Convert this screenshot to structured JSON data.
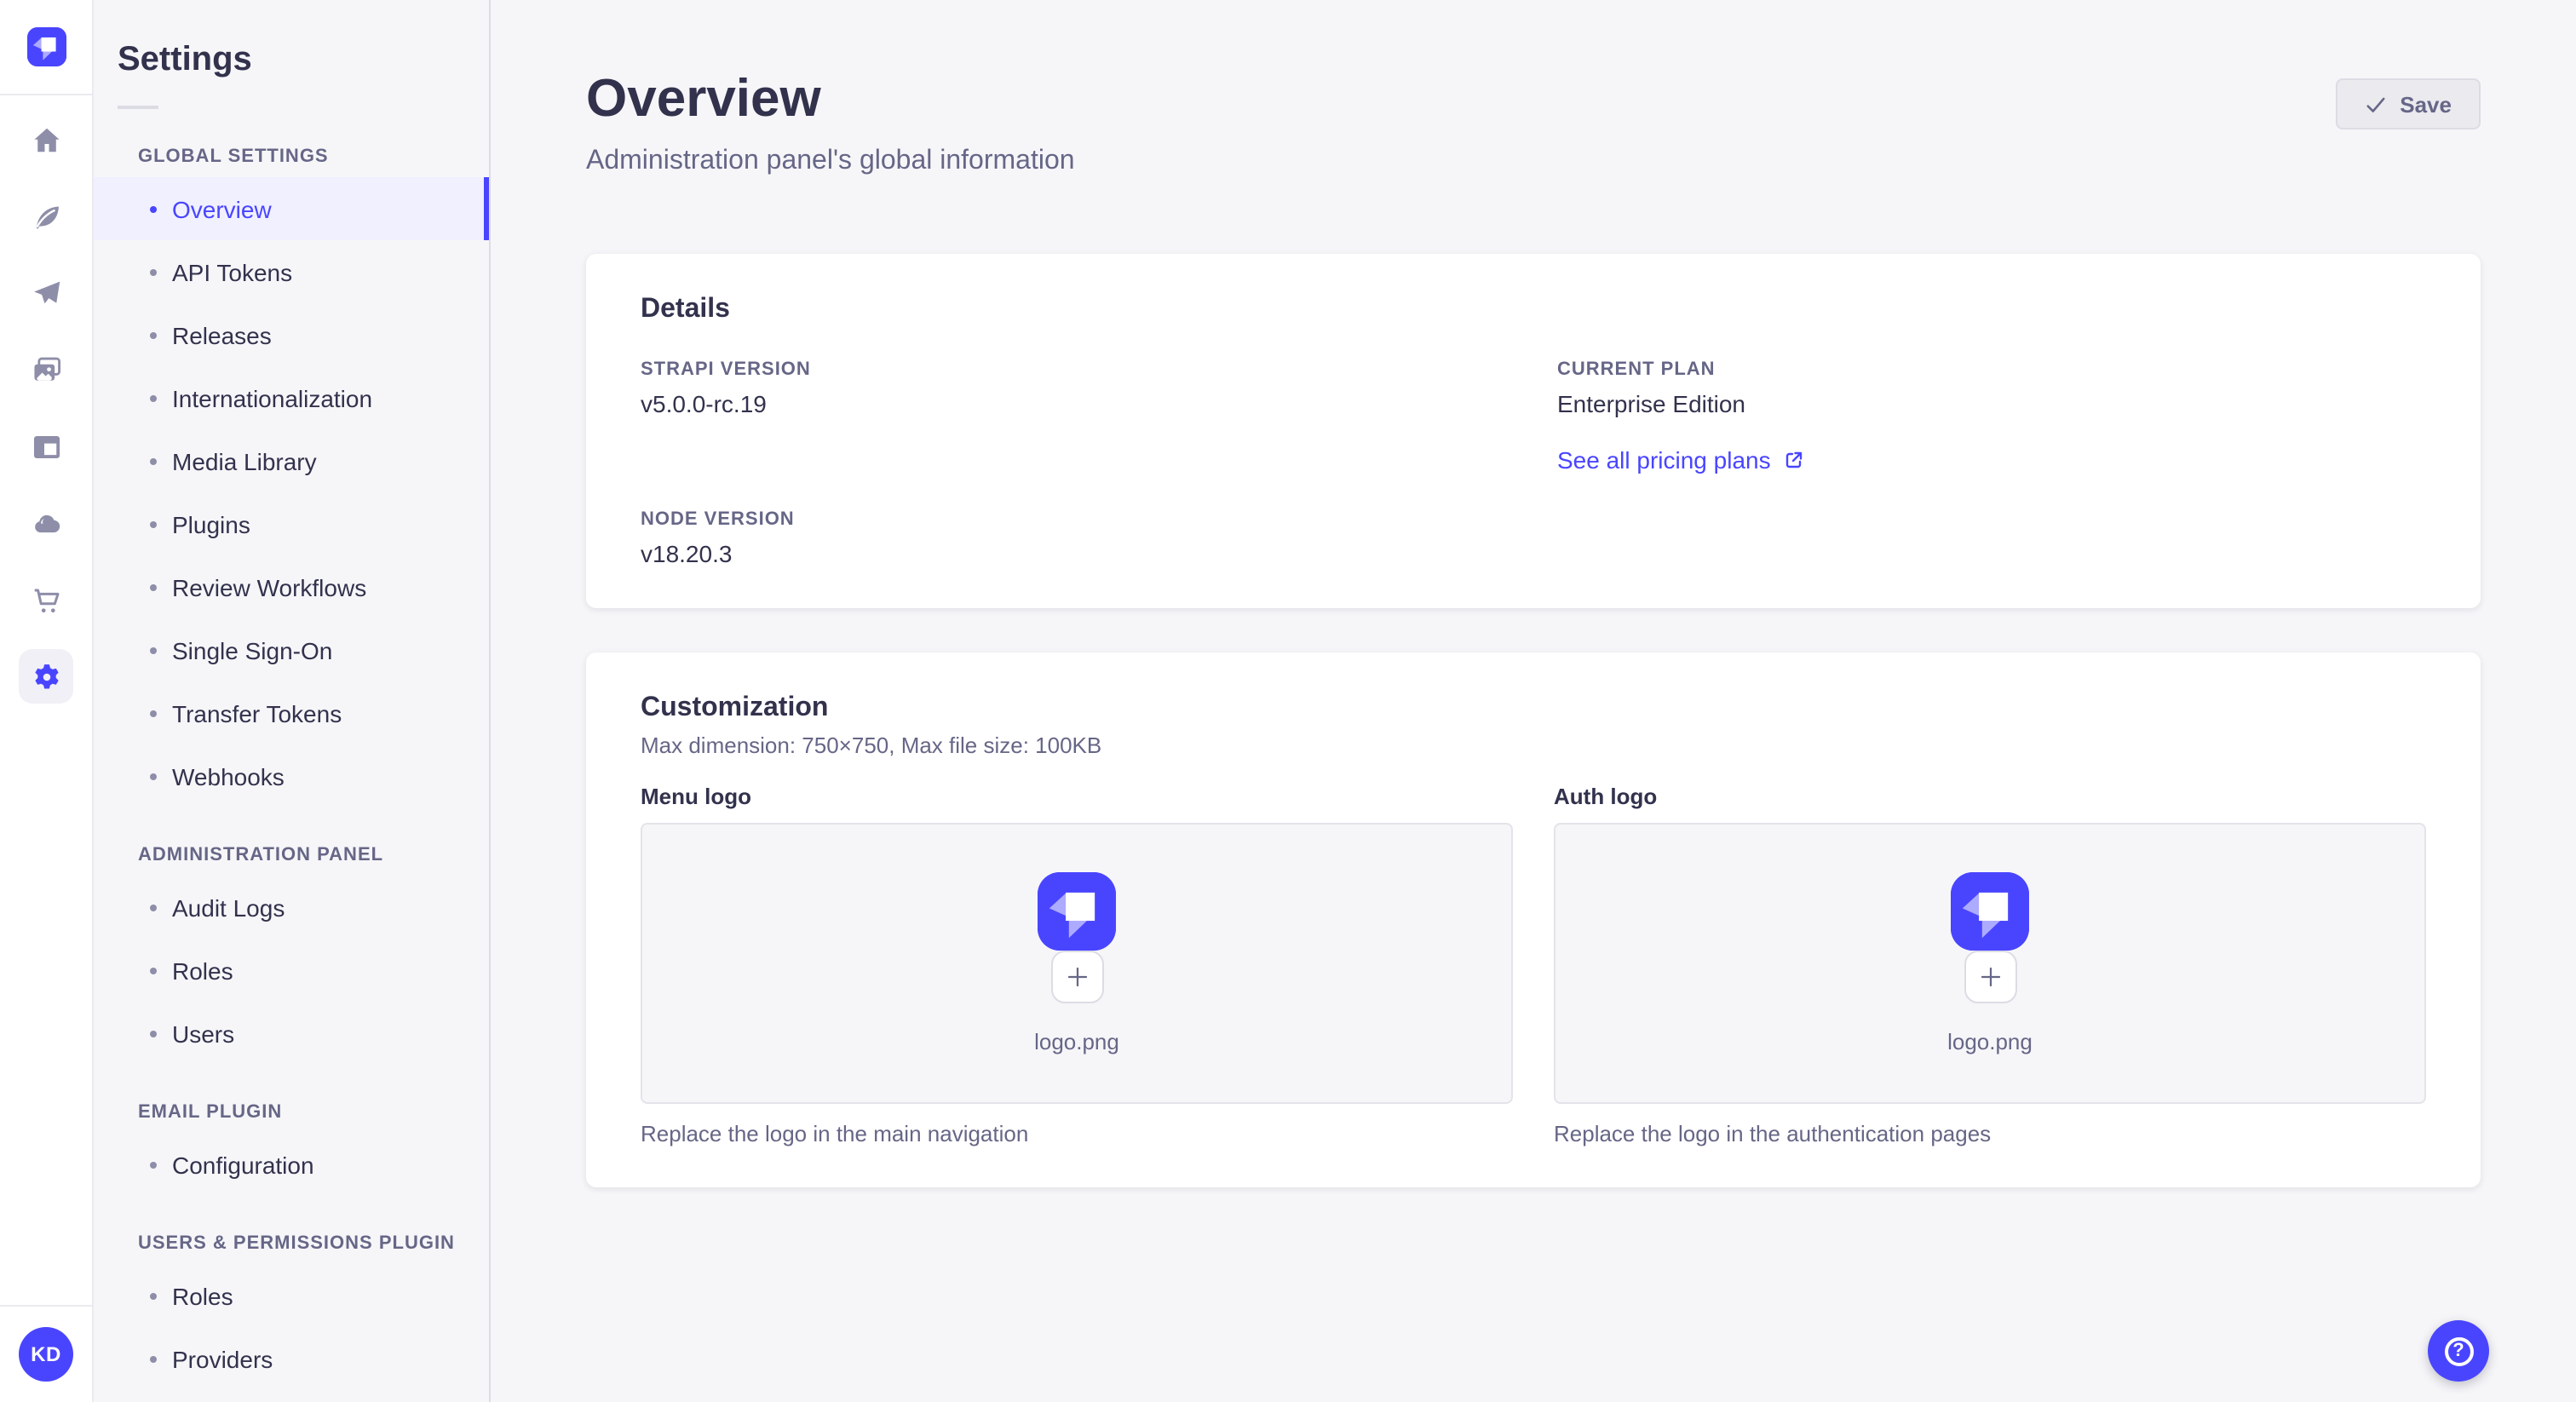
{
  "colors": {
    "accent": "#4945ff",
    "accent_light": "#f0f0ff",
    "text": "#32324d",
    "muted": "#666687",
    "icon_gray": "#8e8ea9",
    "border": "#dcdce4",
    "background": "#f6f6f9",
    "card": "#ffffff"
  },
  "nav_rail": {
    "logo_icon": "strapi-logo",
    "icons": [
      {
        "name": "home",
        "active": false
      },
      {
        "name": "feather",
        "active": false
      },
      {
        "name": "paper-plane",
        "active": false
      },
      {
        "name": "media",
        "active": false
      },
      {
        "name": "layout",
        "active": false
      },
      {
        "name": "cloud",
        "active": false
      },
      {
        "name": "cart",
        "active": false
      },
      {
        "name": "gear",
        "active": true
      }
    ],
    "user": {
      "initials": "KD"
    }
  },
  "subnav": {
    "title": "Settings",
    "sections": [
      {
        "label": "GLOBAL SETTINGS",
        "items": [
          {
            "label": "Overview",
            "active": true
          },
          {
            "label": "API Tokens",
            "active": false
          },
          {
            "label": "Releases",
            "active": false
          },
          {
            "label": "Internationalization",
            "active": false
          },
          {
            "label": "Media Library",
            "active": false
          },
          {
            "label": "Plugins",
            "active": false
          },
          {
            "label": "Review Workflows",
            "active": false
          },
          {
            "label": "Single Sign-On",
            "active": false
          },
          {
            "label": "Transfer Tokens",
            "active": false
          },
          {
            "label": "Webhooks",
            "active": false
          }
        ]
      },
      {
        "label": "ADMINISTRATION PANEL",
        "items": [
          {
            "label": "Audit Logs",
            "active": false
          },
          {
            "label": "Roles",
            "active": false
          },
          {
            "label": "Users",
            "active": false
          }
        ]
      },
      {
        "label": "EMAIL PLUGIN",
        "items": [
          {
            "label": "Configuration",
            "active": false
          }
        ]
      },
      {
        "label": "USERS & PERMISSIONS PLUGIN",
        "items": [
          {
            "label": "Roles",
            "active": false
          },
          {
            "label": "Providers",
            "active": false
          }
        ]
      }
    ]
  },
  "page": {
    "title": "Overview",
    "subtitle": "Administration panel's global information",
    "save_label": "Save"
  },
  "details_card": {
    "title": "Details",
    "fields": [
      {
        "label": "STRAPI VERSION",
        "value": "v5.0.0-rc.19"
      },
      {
        "label": "NODE VERSION",
        "value": "v18.20.3"
      },
      {
        "label": "CURRENT PLAN",
        "value": "Enterprise Edition"
      }
    ],
    "pricing_link_label": "See all pricing plans"
  },
  "customization_card": {
    "title": "Customization",
    "subtitle": "Max dimension: 750×750, Max file size: 100KB",
    "uploads": [
      {
        "label": "Menu logo",
        "filename": "logo.png",
        "caption": "Replace the logo in the main navigation"
      },
      {
        "label": "Auth logo",
        "filename": "logo.png",
        "caption": "Replace the logo in the authentication pages"
      }
    ]
  },
  "help": {
    "glyph": "?"
  }
}
